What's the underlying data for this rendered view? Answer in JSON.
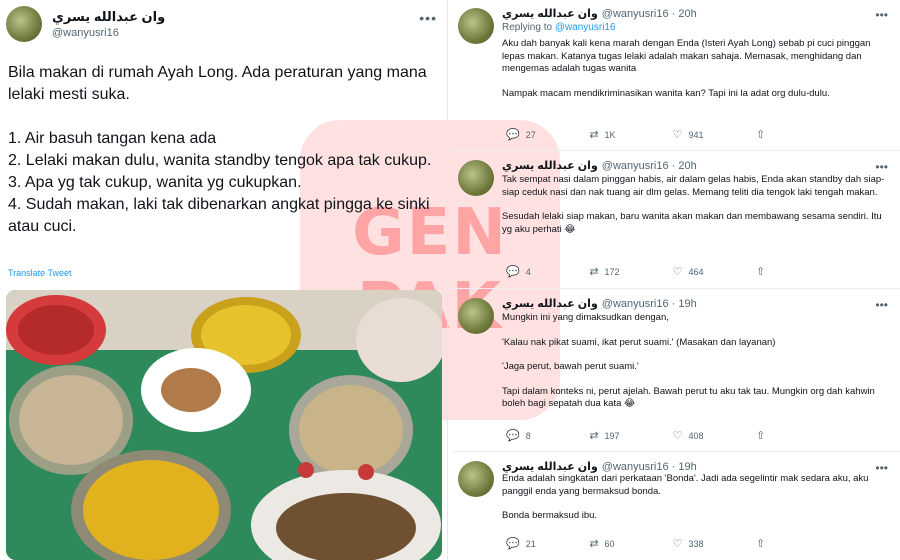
{
  "main_tweet": {
    "name": "وان عبدالله يسري",
    "handle": "@wanyusri16",
    "more": "•••",
    "lines": [
      "Bila makan di rumah Ayah Long. Ada peraturan yang mana lelaki mesti suka.",
      "",
      "1. Air basuh tangan kena ada",
      "2. Lelaki makan dulu, wanita standby tengok apa tak cukup.",
      "3. Apa yg tak cukup, wanita yg cukupkan.",
      "4. Sudah makan, laki tak dibenarkan angkat pingga ke sinki atau cuci."
    ],
    "translate": "Translate Tweet"
  },
  "watermark": {
    "line1": "GEN",
    "line2": "PAK"
  },
  "replies": [
    {
      "name": "وان عبدالله يسري",
      "meta": "@wanyusri16 · 20h",
      "replying_label": "Replying to",
      "replying_handle": "@wanyusri16",
      "paragraphs": [
        "Aku dah banyak kali kena marah dengan Enda (Isteri Ayah Long) sebab pi cuci pinggan lepas makan. Katanya tugas lelaki adalah makan sahaja. Memasak, menghidang dan mengemas adalah tugas wanita",
        "Nampak macam mendikriminasikan wanita kan? Tapi ini la adat org dulu-dulu."
      ],
      "replies": "27",
      "retweets": "1K",
      "likes": "941"
    },
    {
      "name": "وان عبدالله يسري",
      "meta": "@wanyusri16 · 20h",
      "paragraphs": [
        "Tak sempat nasi dalam pinggan habis, air dalam gelas habis, Enda akan standby dah siap-siap ceduk nasi dan nak tuang air dlm gelas. Memang teliti dia tengok laki tengah makan.",
        "Sesudah lelaki siap makan, baru wanita akan makan dan membawang sesama sendiri. Itu yg aku perhati 😂"
      ],
      "replies": "4",
      "retweets": "172",
      "likes": "464"
    },
    {
      "name": "وان عبدالله يسري",
      "meta": "@wanyusri16 · 19h",
      "paragraphs": [
        "Mungkin ini yang dimaksudkan dengan,",
        "'Kalau nak pikat suami, ikat perut suami.' (Masakan dan layanan)",
        "'Jaga perut, bawah perut suami.'",
        "Tapi dalam konteks ni, perut ajelah. Bawah perut tu aku tak tau. Mungkin org dah kahwin boleh bagi sepatah dua kata 😂"
      ],
      "replies": "8",
      "retweets": "197",
      "likes": "408"
    },
    {
      "name": "وان عبدالله يسري",
      "meta": "@wanyusri16 · 19h",
      "paragraphs": [
        "Enda adalah singkatan dari perkataan 'Bonda'. Jadi ada segelintir mak sedara aku, aku panggil enda yang bermaksud bonda.",
        "Bonda bermaksud ibu."
      ],
      "replies": "21",
      "retweets": "60",
      "likes": "338"
    }
  ],
  "icons": {
    "reply": "reply-icon",
    "retweet": "retweet-icon",
    "like": "heart-icon",
    "share": "share-icon",
    "more": "more-icon"
  }
}
